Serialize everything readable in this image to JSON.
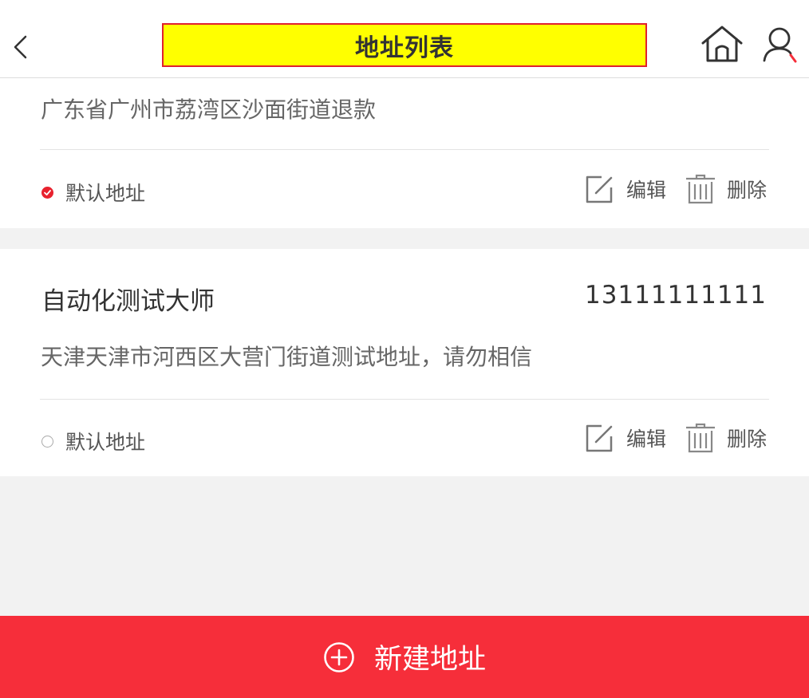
{
  "header": {
    "title": "地址列表",
    "icons": {
      "back": "chevron-left-icon",
      "home": "home-icon",
      "user": "user-icon"
    }
  },
  "addresses": [
    {
      "name": "",
      "phone": "",
      "address": "广东省广州市荔湾区沙面街道退款",
      "is_default": true,
      "default_label": "默认地址",
      "edit_label": "编辑",
      "delete_label": "删除"
    },
    {
      "name": "自动化测试大师",
      "phone": "13111111111",
      "address": "天津天津市河西区大营门街道测试地址，请勿相信",
      "is_default": false,
      "default_label": "默认地址",
      "edit_label": "编辑",
      "delete_label": "删除"
    }
  ],
  "footer": {
    "add_label": "新建地址",
    "icon": "plus-circle-icon"
  },
  "colors": {
    "accent": "#f62e3a",
    "title_highlight": "#ffff00",
    "title_border": "#e0202e",
    "text": "#333333",
    "muted": "#666666"
  }
}
